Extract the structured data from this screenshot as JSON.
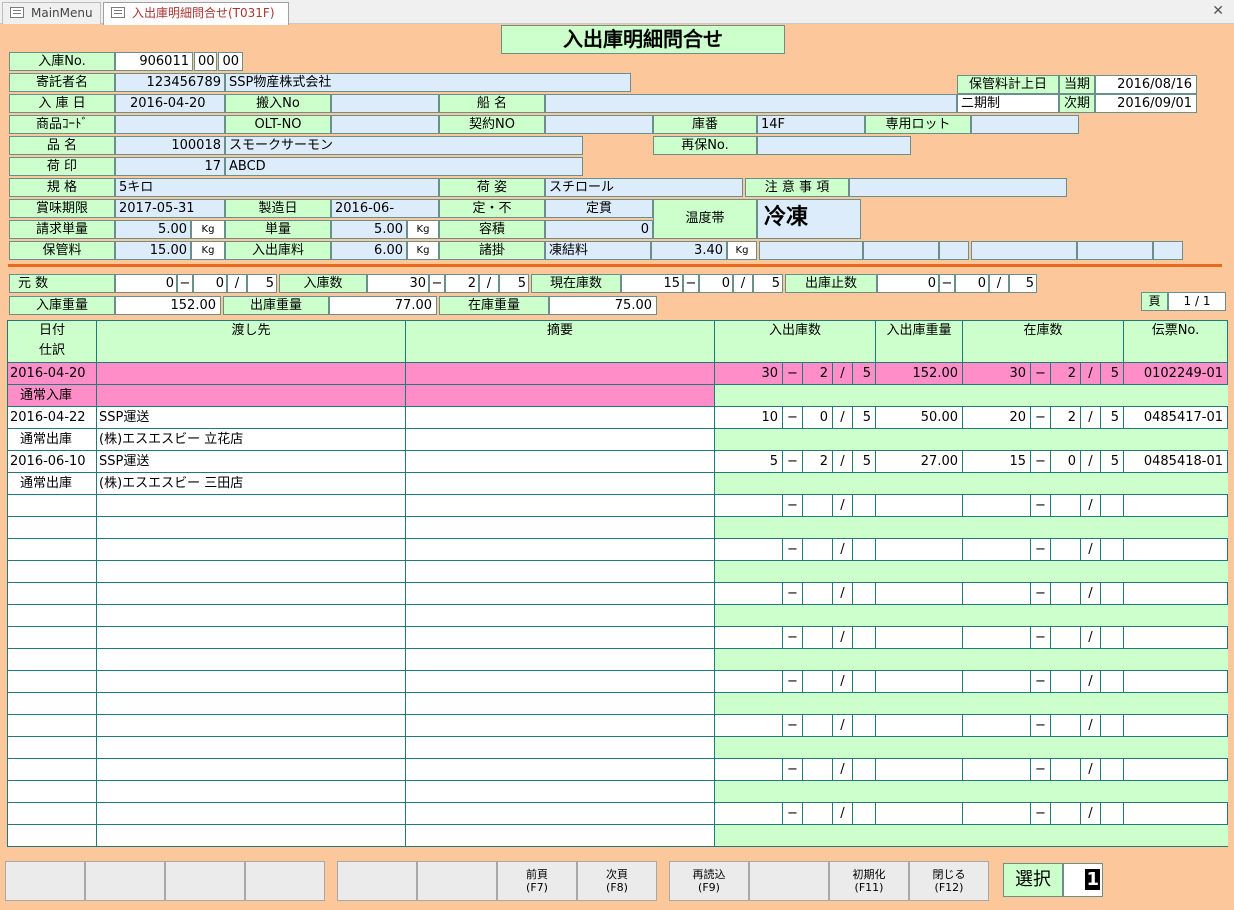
{
  "tabs": {
    "main": "MainMenu",
    "current": "入出庫明細問合せ(T031F)"
  },
  "title": "入出庫明細問合せ",
  "labels": {
    "nyuko_no": "入庫No.",
    "kitakusha": "寄託者名",
    "nyuko_bi": "入 庫 日",
    "hannyu_no": "搬入No",
    "funame": "船 名",
    "shohin_code": "商品ｺｰﾄﾞ",
    "olt_no": "OLT-NO",
    "keiyaku_no": "契約NO",
    "koban": "庫番",
    "senyo_lot": "専用ロット",
    "hinmei": "品 名",
    "saiho_no": "再保No.",
    "nijirushi": "荷 印",
    "kikaku": "規 格",
    "nisugata": "荷 姿",
    "chui": "注 意 事 項",
    "shomi": "賞味期限",
    "seizo": "製造日",
    "tei_fu": "定・不",
    "seikyu_tanryo": "請求単量",
    "tanryo": "単量",
    "yoseki": "容積",
    "ondotai": "温度帯",
    "hokanryo": "保管料",
    "nyushukko_ryo": "入出庫料",
    "shokake": "諸掛",
    "hokan_keijo": "保管料計上日",
    "toki": "当期",
    "jiki": "次期",
    "ganka_su": "元 数",
    "nyuko_su": "入庫数",
    "genzai_su": "現在庫数",
    "shukko_teishi": "出庫止数",
    "nyuko_juryo": "入庫重量",
    "shukko_juryo": "出庫重量",
    "zaiko_juryo": "在庫重量",
    "page": "頁"
  },
  "fields": {
    "nyuko_no": "906011",
    "nyuko_no2": "00",
    "nyuko_no3": "00",
    "kitakusha_code": "123456789",
    "kitakusha_name": "SSP物産株式会社",
    "nyuko_bi": "2016-04-20",
    "koban": "14F",
    "hinmei_code": "100018",
    "hinmei": "スモークサーモン",
    "nijirushi_no": "17",
    "nijirushi": "ABCD",
    "kikaku": "5キロ",
    "nisugata": "スチロール",
    "shomi": "2017-05-31",
    "seizo": "2016-06-",
    "tei_fu": "定貫",
    "seikyu_tanryo": "5.00",
    "tanryo": "5.00",
    "yoseki": "0",
    "ondotai": "冷凍",
    "hokanryo": "15.00",
    "nyushukko_ryo": "6.00",
    "shokake_name": "凍結料",
    "shokake_value": "3.40",
    "unit": "Kg",
    "nikisei": "二期制",
    "toki": "2016/08/16",
    "jiki": "2016/09/01"
  },
  "counts": {
    "ganka": [
      "0",
      "0",
      "5"
    ],
    "nyuko": [
      "30",
      "2",
      "5"
    ],
    "genzai": [
      "15",
      "0",
      "5"
    ],
    "teishi": [
      "0",
      "0",
      "5"
    ],
    "nyuko_juryo": "152.00",
    "shukko_juryo": "77.00",
    "zaiko_juryo": "75.00",
    "page": "1 / 1"
  },
  "table": {
    "headers": {
      "date": "日付",
      "shiwake": "仕訳",
      "watashi": "渡し先",
      "tekiyo": "摘要",
      "su": "入出庫数",
      "juryo": "入出庫重量",
      "zaiko": "在庫数",
      "denpyo": "伝票No."
    },
    "rows": [
      {
        "date": "2016-04-20",
        "shiwake": "通常入庫",
        "dest": "",
        "dest2": "",
        "tekiyo": "",
        "a": "30",
        "b": "2",
        "c": "5",
        "w": "152.00",
        "z1": "30",
        "z2": "2",
        "z3": "5",
        "denpyo": "0102249-01"
      },
      {
        "date": "2016-04-22",
        "shiwake": "通常出庫",
        "dest": "SSP運送",
        "dest2": "(株)エスエスビー 立花店",
        "tekiyo": "",
        "a": "10",
        "b": "0",
        "c": "5",
        "w": "50.00",
        "z1": "20",
        "z2": "2",
        "z3": "5",
        "denpyo": "0485417-01"
      },
      {
        "date": "2016-06-10",
        "shiwake": "通常出庫",
        "dest": "SSP運送",
        "dest2": "(株)エスエスビー 三田店",
        "tekiyo": "",
        "a": "5",
        "b": "2",
        "c": "5",
        "w": "27.00",
        "z1": "15",
        "z2": "0",
        "z3": "5",
        "denpyo": "0485418-01"
      }
    ]
  },
  "buttons": [
    "",
    "",
    "",
    "",
    "",
    "",
    "前頁\n(F7)",
    "次頁\n(F8)",
    "再読込\n(F9)",
    "",
    "初期化\n(F11)",
    "閉じる\n(F12)"
  ],
  "select": {
    "label": "選択",
    "value": "1"
  }
}
